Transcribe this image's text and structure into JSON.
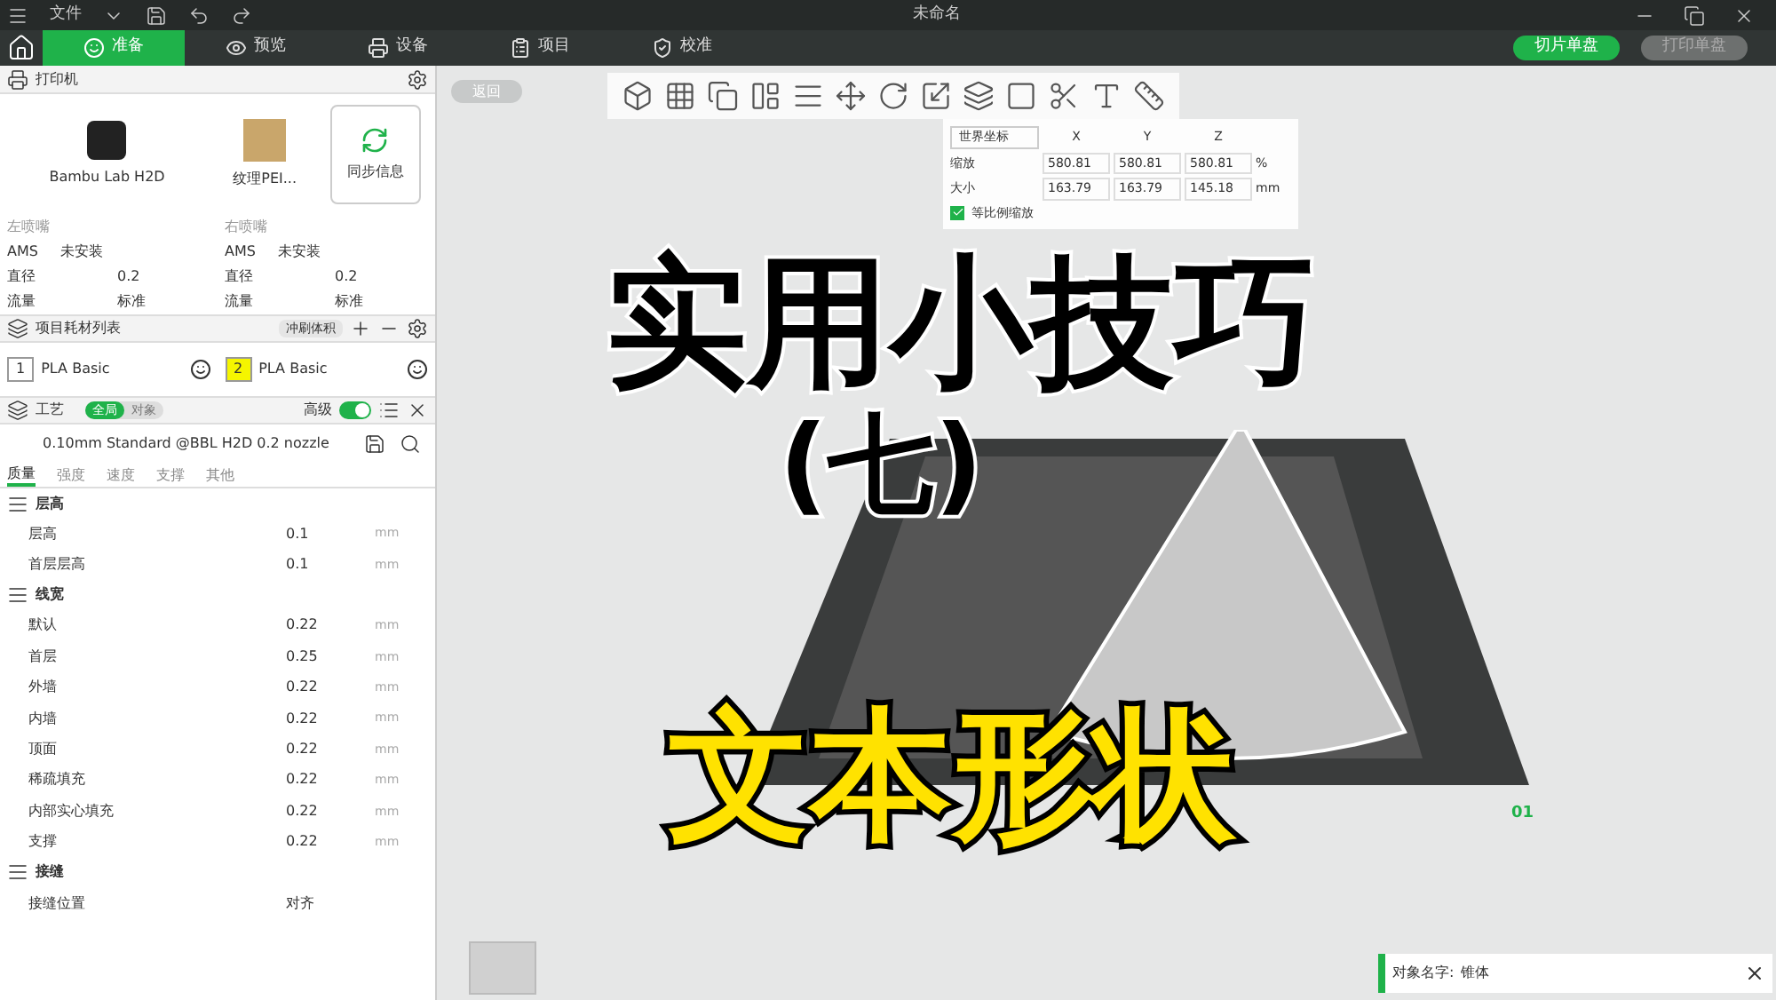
{
  "window": {
    "menu": "文件",
    "title": "未命名"
  },
  "tabs": [
    {
      "label": "准备",
      "selected": true
    },
    {
      "label": "预览",
      "selected": false
    },
    {
      "label": "设备",
      "selected": false
    },
    {
      "label": "项目",
      "selected": false
    },
    {
      "label": "校准",
      "selected": false
    }
  ],
  "actions": [
    {
      "label": "切片单盘",
      "disabled": false
    },
    {
      "label": "打印单盘",
      "disabled": true
    }
  ],
  "printer": {
    "title": "打印机",
    "model": "Bambu Lab H2D",
    "plate": "纹理PEI...",
    "sync": "同步信息",
    "nozzles": [
      {
        "title": "左喷嘴",
        "ams_label": "AMS",
        "ams": "未安装",
        "diameter_label": "直径",
        "diameter": "0.2",
        "flow_label": "流量",
        "flow": "标准"
      },
      {
        "title": "右喷嘴",
        "ams_label": "AMS",
        "ams": "未安装",
        "diameter_label": "直径",
        "diameter": "0.2",
        "flow_label": "流量",
        "flow": "标准"
      }
    ]
  },
  "filaments": {
    "title": "项目耗材列表",
    "flush_button": "冲刷体积",
    "items": [
      {
        "index": "1",
        "name": "PLA Basic",
        "color": "#ffffff"
      },
      {
        "index": "2",
        "name": "PLA Basic",
        "color": "#f5f500"
      }
    ]
  },
  "process": {
    "title": "工艺",
    "scope": [
      {
        "label": "全局",
        "selected": true
      },
      {
        "label": "对象",
        "selected": false
      }
    ],
    "advanced_label": "高级",
    "advanced": true,
    "preset": "0.10mm Standard @BBL H2D 0.2 nozzle",
    "tabs": [
      {
        "label": "质量",
        "selected": true
      },
      {
        "label": "强度",
        "selected": false
      },
      {
        "label": "速度",
        "selected": false
      },
      {
        "label": "支撑",
        "selected": false
      },
      {
        "label": "其他",
        "selected": false
      }
    ],
    "groups": [
      {
        "title": "层高",
        "rows": [
          {
            "label": "层高",
            "value": "0.1",
            "unit": "mm"
          },
          {
            "label": "首层层高",
            "value": "0.1",
            "unit": "mm"
          }
        ]
      },
      {
        "title": "线宽",
        "rows": [
          {
            "label": "默认",
            "value": "0.22",
            "unit": "mm"
          },
          {
            "label": "首层",
            "value": "0.25",
            "unit": "mm"
          },
          {
            "label": "外墙",
            "value": "0.22",
            "unit": "mm"
          },
          {
            "label": "内墙",
            "value": "0.22",
            "unit": "mm"
          },
          {
            "label": "顶面",
            "value": "0.22",
            "unit": "mm"
          },
          {
            "label": "稀疏填充",
            "value": "0.22",
            "unit": "mm"
          },
          {
            "label": "内部实心填充",
            "value": "0.22",
            "unit": "mm"
          },
          {
            "label": "支撑",
            "value": "0.22",
            "unit": "mm"
          }
        ]
      },
      {
        "title": "接缝",
        "rows": [
          {
            "label": "接缝位置",
            "value": "对齐",
            "unit": ""
          }
        ]
      }
    ]
  },
  "canvas": {
    "back_button": "返回",
    "scale_panel": {
      "coords": "世界坐标",
      "axes": [
        "X",
        "Y",
        "Z"
      ],
      "rows": [
        {
          "label": "缩放",
          "values": [
            "580.81",
            "580.81",
            "580.81"
          ],
          "unit": "%"
        },
        {
          "label": "大小",
          "values": [
            "163.79",
            "163.79",
            "145.18"
          ],
          "unit": "mm"
        }
      ],
      "uniform_label": "等比例缩放",
      "uniform": true
    },
    "plate_number": "01",
    "overlay": {
      "title": "实用小技巧",
      "subtitle": "(七)",
      "caption": "文本形状"
    },
    "notification": {
      "label": "对象名字:",
      "value": "锥体"
    }
  }
}
